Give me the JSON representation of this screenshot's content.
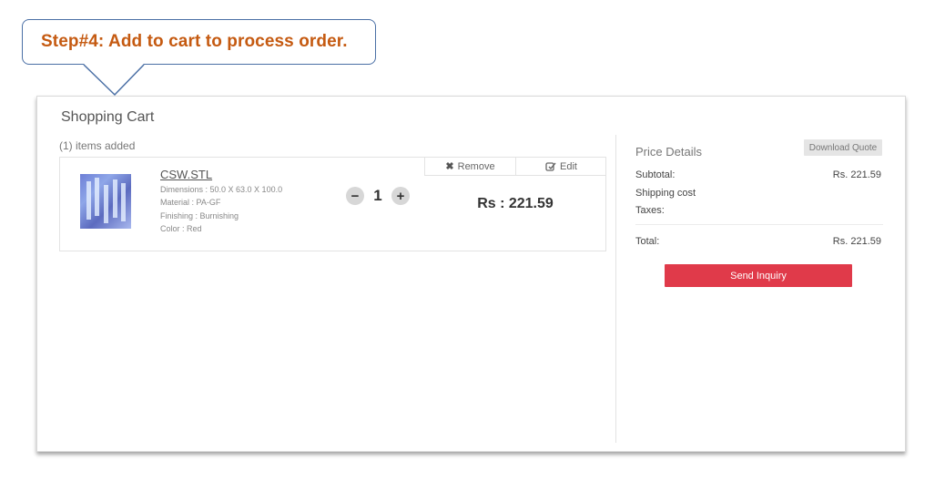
{
  "callout": {
    "text": "Step#4: Add to cart to process order."
  },
  "cart": {
    "title": "Shopping Cart",
    "items_added": "(1) items added",
    "item": {
      "name": "CSW.STL",
      "dimensions": "Dimensions : 50.0 X 63.0 X 100.0",
      "material": "Material : PA-GF",
      "finishing": "Finishing : Burnishing",
      "color": "Color : Red",
      "quantity": "1",
      "minus": "−",
      "plus": "+",
      "remove_label": "Remove",
      "edit_label": "Edit",
      "price": "Rs : 221.59"
    }
  },
  "summary": {
    "title": "Price Details",
    "download_label": "Download Quote",
    "subtotal_label": "Subtotal:",
    "subtotal_value": "Rs. 221.59",
    "shipping_label": "Shipping cost",
    "taxes_label": "Taxes:",
    "total_label": "Total:",
    "total_value": "Rs. 221.59",
    "send_label": "Send Inquiry"
  },
  "colors": {
    "callout_text": "#c55a11",
    "callout_border": "#4a6fa5",
    "send_button": "#e03a4a"
  }
}
